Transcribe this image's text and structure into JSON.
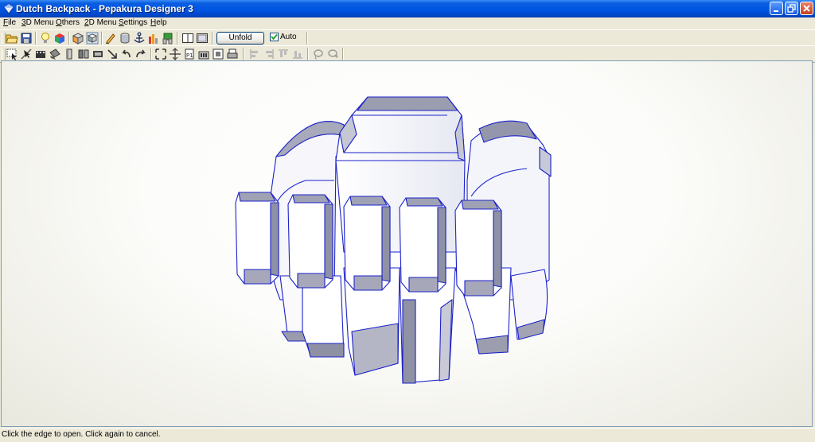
{
  "window": {
    "title": "Dutch Backpack - Pepakura Designer 3",
    "controls": [
      "minimize",
      "restore",
      "close"
    ]
  },
  "menubar": {
    "items": [
      {
        "label": "File",
        "accel": "F",
        "rest": "ile"
      },
      {
        "label": "3D Menu",
        "accel": "3",
        "rest": "D Menu"
      },
      {
        "label": "Others",
        "accel": "O",
        "rest": "thers"
      },
      {
        "label": "2D Menu",
        "accel": "2",
        "rest": "D Menu"
      },
      {
        "label": "Settings",
        "accel": "S",
        "rest": "ettings"
      },
      {
        "label": "Help",
        "accel": "H",
        "rest": "elp"
      }
    ]
  },
  "toolbar1": {
    "icons": [
      "open-file-icon",
      "save-icon",
      "lightbulb-icon",
      "colored-cube-icon",
      "cube-tool-icon",
      "cube-face-icon",
      "pencil-icon",
      "cylinder-icon",
      "anchor-icon",
      "color-bars-icon",
      "flag-tool-icon",
      "single-pane-icon",
      "dual-pane-icon"
    ],
    "unfold_label": "Unfold",
    "auto_label": "Auto",
    "auto_checked": true
  },
  "toolbar2": {
    "icons": [
      "select-tool-icon",
      "edge-tool-icon",
      "cut-tool-icon",
      "fold-tool-icon",
      "flap-tool-icon",
      "join-tool-icon",
      "rotate-tool-icon",
      "move-tool-icon",
      "undo-arrow-icon",
      "redo-arrow-icon",
      "zoom-box-icon",
      "zoom-fit-icon",
      "page-tool-icon",
      "text-tool-icon",
      "image-tool-icon",
      "print-icon",
      "align-left-icon",
      "align-right-icon",
      "align-top-icon",
      "align-bottom-icon",
      "lasso-icon",
      "lasso-add-icon"
    ]
  },
  "viewport": {
    "content": "3D model view",
    "model_stroke": "#1b22c8",
    "model_fill_light": "#ffffff",
    "model_fill_shadow": "#8c8ea0"
  },
  "statusbar": {
    "message": "Click the edge to open. Click again to cancel."
  }
}
